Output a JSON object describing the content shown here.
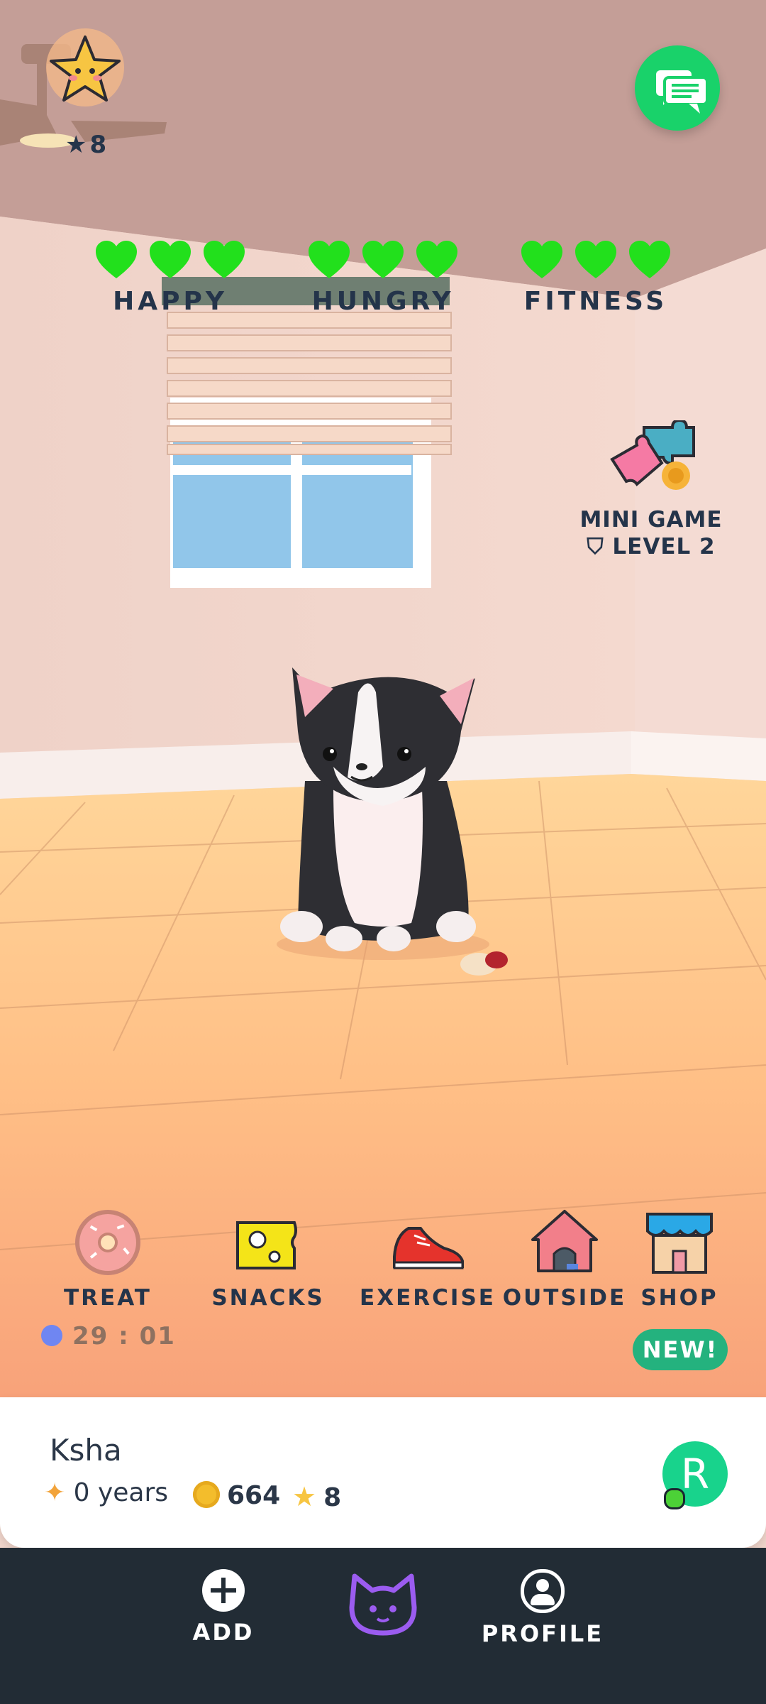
{
  "header": {
    "star_count": "8"
  },
  "stats": [
    {
      "label": "HAPPY",
      "hearts": 3
    },
    {
      "label": "HUNGRY",
      "hearts": 3
    },
    {
      "label": "FITNESS",
      "hearts": 3
    }
  ],
  "mini_game": {
    "title": "MINI GAME",
    "level": "LEVEL 2"
  },
  "actions": {
    "treat": "TREAT",
    "snacks": "SNACKS",
    "exercise": "EXERCISE",
    "outside": "OUTSIDE",
    "shop": "SHOP",
    "treat_timer": "29 : 01",
    "shop_badge": "NEW!"
  },
  "pet": {
    "name": "Ksha",
    "age": "0 years",
    "coins": "664",
    "stars": "8",
    "avatar_letter": "R"
  },
  "nav": {
    "add": "ADD",
    "profile": "PROFILE"
  },
  "colors": {
    "heart": "#22e01c",
    "text_dark": "#24344a",
    "chat_green": "#19d26a",
    "new_badge": "#24b27e",
    "nav_bg": "#222c35",
    "cat_nav_purple": "#9b5cf0"
  }
}
